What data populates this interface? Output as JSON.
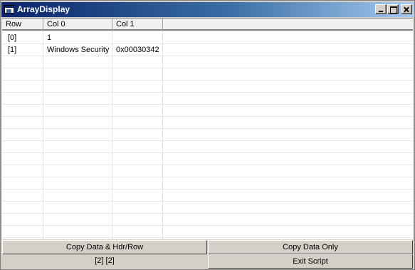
{
  "window": {
    "title": "ArrayDisplay"
  },
  "grid": {
    "columns": [
      "Row",
      "Col 0",
      "Col 1"
    ],
    "rows": [
      {
        "row": "[0]",
        "col0": "1",
        "col1": ""
      },
      {
        "row": "[1]",
        "col0": "Windows Security",
        "col1": "0x00030342"
      }
    ]
  },
  "footer": {
    "copy_hdr_label": "Copy Data & Hdr/Row",
    "copy_data_label": "Copy Data Only",
    "dims_text": "[2] [2]",
    "exit_label": "Exit Script"
  }
}
